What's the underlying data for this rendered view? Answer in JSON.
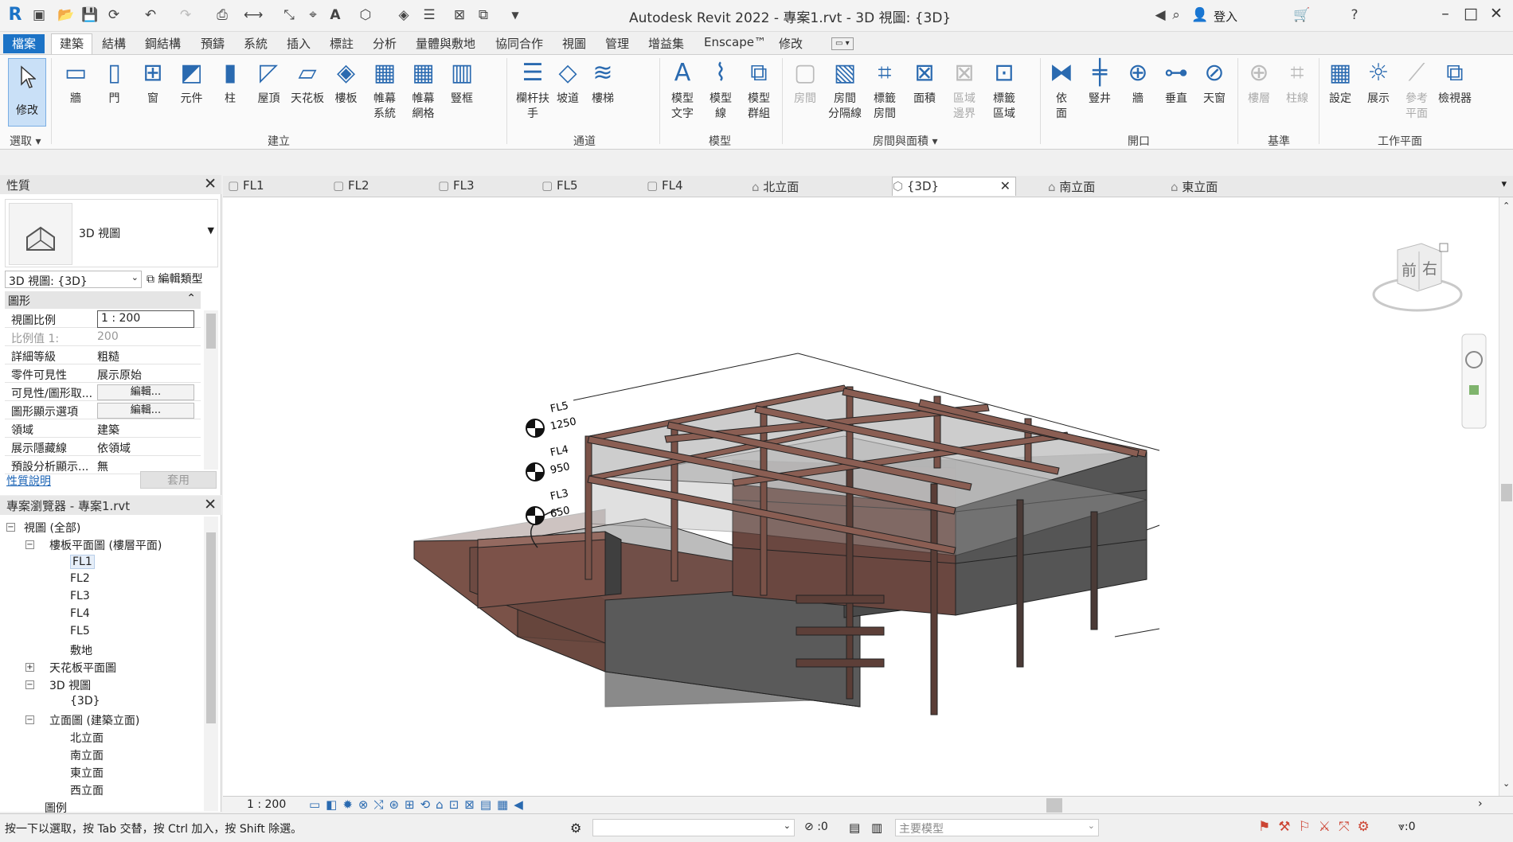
{
  "titlebar": {
    "title": "Autodesk Revit 2022 - 專案1.rvt - 3D 視圖: {3D}",
    "signin": "登入"
  },
  "menu": {
    "file": "檔案",
    "tabs": [
      "建築",
      "結構",
      "鋼結構",
      "預鑄",
      "系統",
      "插入",
      "標註",
      "分析",
      "量體與敷地",
      "協同合作",
      "視圖",
      "管理",
      "增益集",
      "Enscape™",
      "修改"
    ]
  },
  "ribbon": {
    "select": "修改",
    "select_group": "選取",
    "build": [
      "牆",
      "門",
      "窗",
      "元件",
      "柱",
      "屋頂",
      "天花板",
      "樓板",
      "帷幕\n系統",
      "帷幕\n網格",
      "豎框"
    ],
    "build_group": "建立",
    "circ": [
      "欄杆扶手",
      "坡道",
      "樓梯"
    ],
    "circ_group": "通道",
    "model": [
      "模型\n文字",
      "模型\n線",
      "模型\n群組"
    ],
    "model_group": "模型",
    "room": [
      "房間",
      "房間\n分隔線",
      "標籤\n房間",
      "面積",
      "區域\n邊界",
      "標籤\n區域"
    ],
    "room_group": "房間與面積",
    "open": [
      "依\n面",
      "豎井",
      "牆",
      "垂直",
      "天窗"
    ],
    "open_group": "開口",
    "datum": [
      "樓層",
      "柱線"
    ],
    "datum_group": "基準",
    "work": [
      "設定",
      "展示",
      "參考\n平面",
      "檢視器"
    ],
    "work_group": "工作平面"
  },
  "properties": {
    "title": "性質",
    "type_name": "3D 視圖",
    "instance": "3D 視圖: {3D}",
    "edit_type": "編輯類型",
    "section": "圖形",
    "rows": [
      {
        "k": "視圖比例",
        "v": "1 : 200"
      },
      {
        "k": "比例值 1:",
        "v": "200"
      },
      {
        "k": "詳細等級",
        "v": "粗糙"
      },
      {
        "k": "零件可見性",
        "v": "展示原始"
      },
      {
        "k": "可見性/圖形取...",
        "v": "編輯..."
      },
      {
        "k": "圖形顯示選項",
        "v": "編輯..."
      },
      {
        "k": "領域",
        "v": "建築"
      },
      {
        "k": "展示隱藏線",
        "v": "依領域"
      },
      {
        "k": "預設分析顯示...",
        "v": "無"
      }
    ],
    "help": "性質說明",
    "apply": "套用"
  },
  "browser": {
    "title": "專案瀏覽器 - 專案1.rvt",
    "items": [
      "視圖 (全部)",
      "樓板平面圖 (樓層平面)",
      "FL1",
      "FL2",
      "FL3",
      "FL4",
      "FL5",
      "敷地",
      "天花板平面圖",
      "3D 視圖",
      "{3D}",
      "立面圖 (建築立面)",
      "北立面",
      "南立面",
      "東立面",
      "西立面",
      "圖例"
    ]
  },
  "doctabs": [
    "FL1",
    "FL2",
    "FL3",
    "FL5",
    "FL4",
    "北立面",
    "{3D}",
    "南立面",
    "東立面"
  ],
  "levels": [
    {
      "name": "FL5",
      "elev": "1250"
    },
    {
      "name": "FL4",
      "elev": "950"
    },
    {
      "name": "FL3",
      "elev": "650"
    }
  ],
  "viewcube": {
    "front": "前",
    "right": "右"
  },
  "viewctl": {
    "scale": "1 : 200"
  },
  "status": {
    "hint": "按一下以選取，按 Tab 交替，按 Ctrl 加入，按 Shift 除選。",
    "count": ":0",
    "model": "主要模型",
    "filter": ":0"
  }
}
